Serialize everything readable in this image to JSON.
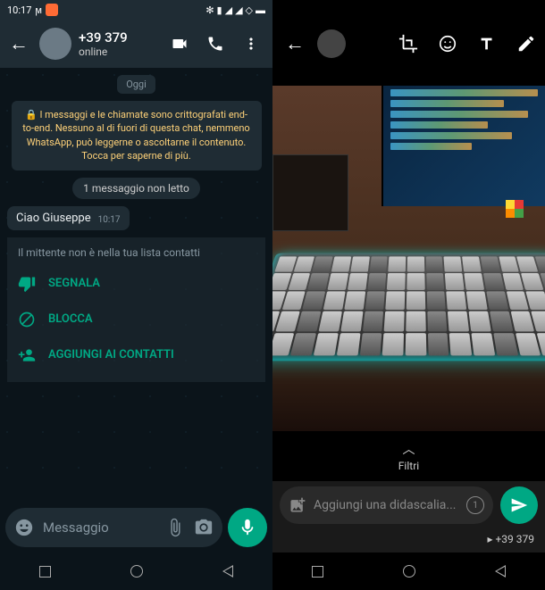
{
  "statusbar": {
    "time": "10:17",
    "icons": [
      "bluetooth",
      "signal",
      "signal",
      "wifi",
      "battery"
    ]
  },
  "left": {
    "header": {
      "phone": "+39 379",
      "status": "online"
    },
    "date": "Oggi",
    "encryption": "🔒 I messaggi e le chiamate sono crittografati end-to-end. Nessuno al di fuori di questa chat, nemmeno WhatsApp, può leggerne o ascoltarne il contenuto. Tocca per saperne di più.",
    "unread": "1 messaggio non letto",
    "message": {
      "text": "Ciao Giuseppe",
      "time": "10:17"
    },
    "spam_notice": "Il mittente non è nella tua lista contatti",
    "actions": {
      "report": "SEGNALA",
      "block": "BLOCCA",
      "add": "AGGIUNGI AI CONTATTI"
    },
    "input_placeholder": "Messaggio"
  },
  "right": {
    "filters_label": "Filtri",
    "caption_placeholder": "Aggiungi una didascalia...",
    "recipient": "+39 379"
  }
}
